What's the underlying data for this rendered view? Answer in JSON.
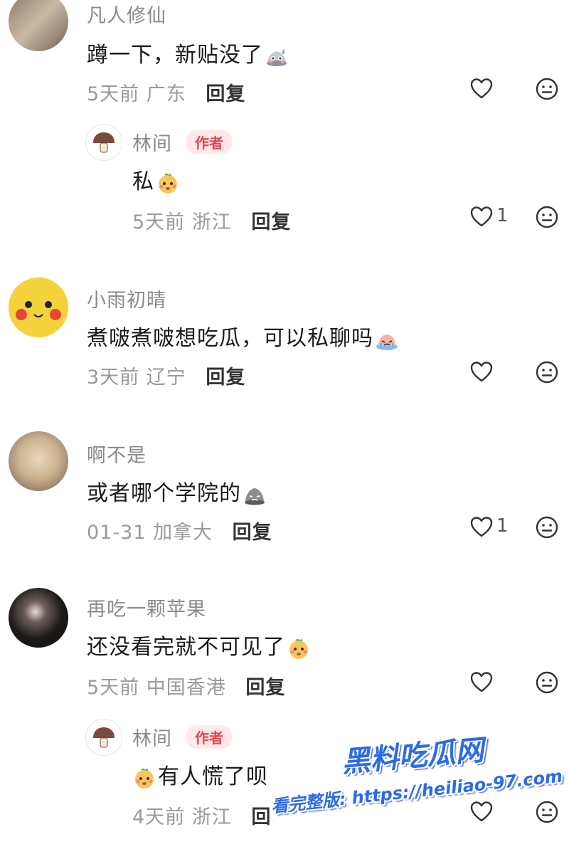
{
  "comments": [
    {
      "user": "凡人修仙",
      "text": "蹲一下，新贴没了",
      "time": "5天前",
      "location": "广东",
      "reply_label": "回复",
      "like_count": "",
      "replies": [
        {
          "user": "林间",
          "badge": "作者",
          "text": "私",
          "time": "5天前",
          "location": "浙江",
          "reply_label": "回复",
          "like_count": "1"
        }
      ]
    },
    {
      "user": "小雨初晴",
      "text": "煮啵煮啵想吃瓜，可以私聊吗",
      "time": "3天前",
      "location": "辽宁",
      "reply_label": "回复",
      "like_count": ""
    },
    {
      "user": "啊不是",
      "text": "或者哪个学院的",
      "time": "01-31",
      "location": "加拿大",
      "reply_label": "回复",
      "like_count": "1"
    },
    {
      "user": "再吃一颗苹果",
      "text": "还没看完就不可见了",
      "time": "5天前",
      "location": "中国香港",
      "reply_label": "回复",
      "like_count": "",
      "replies": [
        {
          "user": "林间",
          "badge": "作者",
          "text": "有人慌了呗",
          "time": "4天前",
          "location": "浙江",
          "reply_label": "回",
          "like_count": ""
        }
      ]
    }
  ],
  "watermark": {
    "brand": "黑料吃瓜网",
    "line": "看完整版: https://heiliao-97.com"
  },
  "icons": {
    "like": "heart-outline-icon",
    "dislike": "neutral-face-icon",
    "emoji": "emoji-icon"
  },
  "colors": {
    "author_badge_text": "#e8434e",
    "author_badge_bg": "#fde8ea",
    "watermark": "#2b6be8"
  }
}
